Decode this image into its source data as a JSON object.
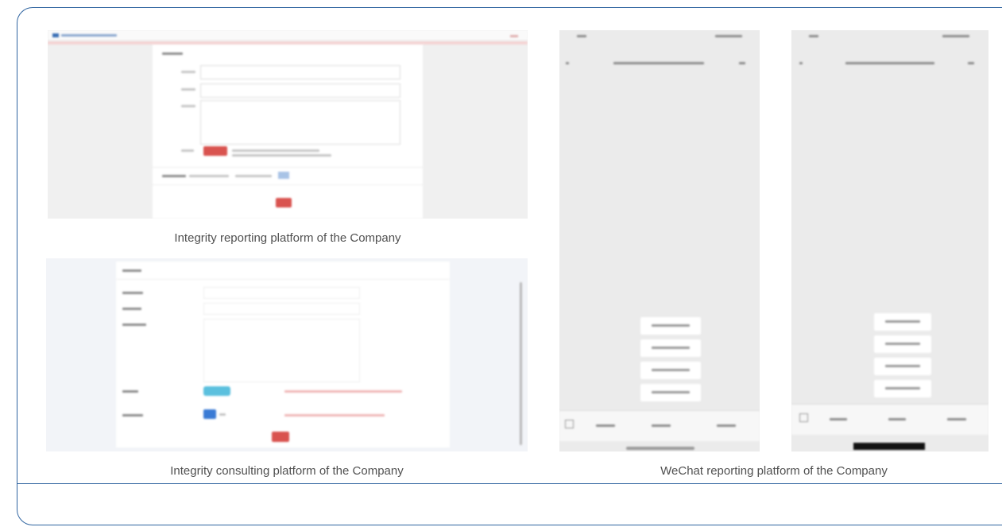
{
  "captions": {
    "integrity_reporting": "Integrity reporting platform of the Company",
    "integrity_consulting": "Integrity consulting platform of the Company",
    "wechat_reporting": "WeChat reporting platform of the Company"
  },
  "colors": {
    "frame_border": "#2f64a0",
    "caption_text": "#505050",
    "submit_red": "#d9534f",
    "upload_teal": "#5bc0de",
    "select_blue": "#3a7bd5"
  }
}
